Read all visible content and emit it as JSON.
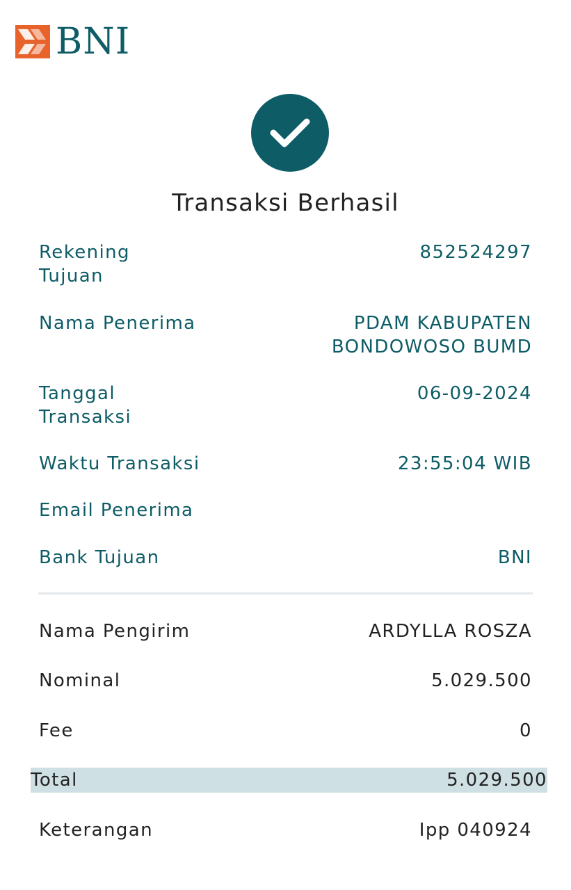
{
  "header": {
    "logo_text": "BNI"
  },
  "status": {
    "icon": "checkmark-icon",
    "title": "Transaksi Berhasil"
  },
  "recipient": {
    "rekening_label": "Rekening Tujuan",
    "rekening_value": "852524297",
    "nama_label": "Nama Penerima",
    "nama_value_line1": "PDAM KABUPATEN",
    "nama_value_line2": "BONDOWOSO BUMD",
    "tanggal_label": "Tanggal Transaksi",
    "tanggal_value": "06-09-2024",
    "waktu_label": "Waktu Transaksi",
    "waktu_value": "23:55:04 WIB",
    "email_label": "Email Penerima",
    "email_value": "",
    "bank_label": "Bank Tujuan",
    "bank_value": "BNI"
  },
  "details": {
    "pengirim_label": "Nama Pengirim",
    "pengirim_value": "ARDYLLA ROSZA",
    "nominal_label": "Nominal",
    "nominal_value": "5.029.500",
    "fee_label": "Fee",
    "fee_value": "0",
    "total_label": "Total",
    "total_value": "5.029.500",
    "keterangan_label": "Keterangan",
    "keterangan_value": "Ipp 040924"
  },
  "colors": {
    "brand_teal": "#0d5c66",
    "brand_orange": "#e8632b",
    "total_highlight": "#cfe0e4",
    "text_dark": "#222222"
  }
}
